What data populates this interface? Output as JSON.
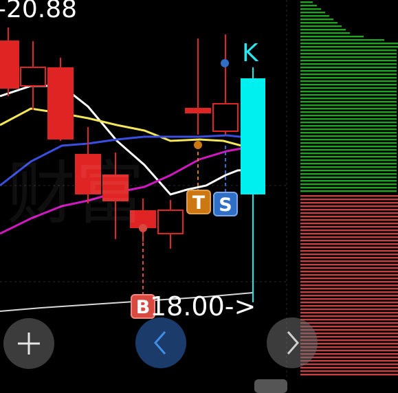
{
  "price_label": "-20.88",
  "target_label": "18.00->",
  "watermark": "财富",
  "chart_data": {
    "type": "candlestick",
    "candles": [
      {
        "open": 60,
        "close": 128,
        "high": 40,
        "low": 140,
        "color": "red"
      },
      {
        "open": 98,
        "close": 125,
        "high": 60,
        "low": 160,
        "color": "red"
      },
      {
        "open": 99,
        "close": 202,
        "high": 84,
        "low": 205,
        "color": "red"
      },
      {
        "open": 225,
        "close": 282,
        "high": 185,
        "low": 296,
        "color": "red"
      },
      {
        "open": 255,
        "close": 292,
        "high": 222,
        "low": 348,
        "color": "red"
      },
      {
        "open": 307,
        "close": 331,
        "high": 289,
        "low": 352,
        "color": "red"
      },
      {
        "open": 306,
        "close": 340,
        "high": 291,
        "low": 362,
        "color": "red"
      },
      {
        "open": 158,
        "close": 164,
        "high": 56,
        "low": 196,
        "color": "red"
      },
      {
        "open": 151,
        "close": 191,
        "high": 50,
        "low": 196,
        "color": "red"
      },
      {
        "open": 115,
        "close": 282,
        "high": 98,
        "low": 440,
        "color": "cyan"
      }
    ],
    "markers": [
      {
        "label": "T",
        "color": "#cc7711"
      },
      {
        "label": "S",
        "color": "#2f6fc8"
      },
      {
        "label": "B",
        "color": "#d84a3f"
      },
      {
        "label": "K",
        "color": "#27e7f1"
      }
    ]
  },
  "colors": {
    "red": "#e02424",
    "cyan": "#00f0f0",
    "green_bars": "#1fa51f",
    "red_bars": "#c94040",
    "white_line": "#ffffff",
    "yellow_line": "#f3e65a",
    "blue_line": "#3a4ee0",
    "magenta_line": "#d018c0",
    "gray_line": "#d9d9d9"
  },
  "icons": {
    "plus": "plus-icon",
    "prev": "chevron-left-icon",
    "next": "chevron-right-icon"
  }
}
